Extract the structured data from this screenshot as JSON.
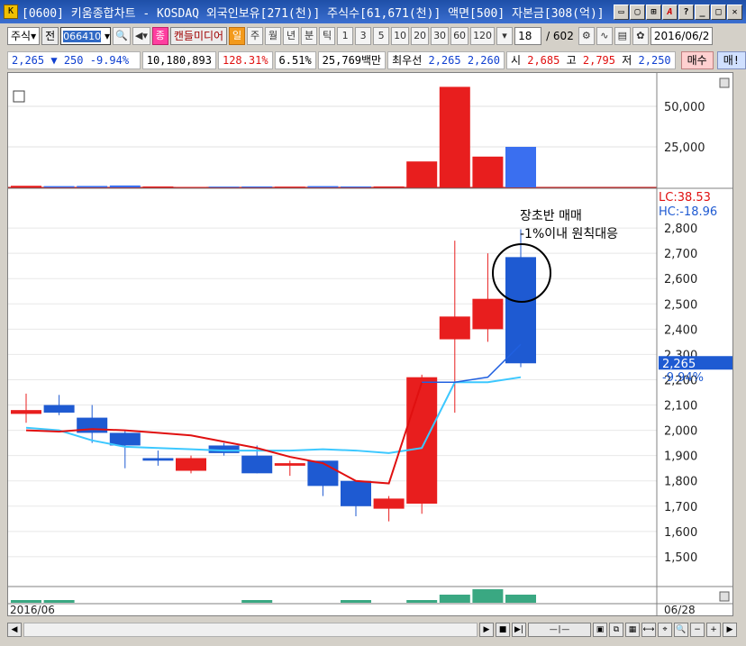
{
  "window": {
    "title": "[0600] 키움종합차트 - KOSDAQ 외국인보유[271(천)] 주식수[61,671(천)] 액면[500] 자본금[308(억)]",
    "icons": [
      "minimize-window-icon",
      "restore-window-icon",
      "pin-icon",
      "font-icon",
      "help-icon",
      "minimize-icon",
      "maximize-icon",
      "close-icon"
    ]
  },
  "toolbar": {
    "type_select": "주식",
    "all_label": "전",
    "code": "066410",
    "theme_btn": "종",
    "candle_btn": "캔들미디어",
    "period_daily": "일",
    "period_weekly": "주",
    "period_monthly": "월",
    "period_yearly": "년",
    "period_minute": "분",
    "period_tick": "틱",
    "minute_options": [
      "1",
      "3",
      "5",
      "10",
      "20",
      "30",
      "60",
      "120"
    ],
    "count_value": "18",
    "total_count": "/ 602",
    "date": "2016/06/2"
  },
  "quote": {
    "price": "2,265",
    "change": "250",
    "change_pct": "-9.94%",
    "volume": "10,180,893",
    "vol_ratio": "128.31%",
    "turnover": "6.51%",
    "amount": "25,769백만",
    "best_label": "최우선",
    "ask": "2,265",
    "bid": "2,260",
    "open_label": "시",
    "open": "2,685",
    "high_label": "고",
    "high": "2,795",
    "low_label": "저",
    "low": "2,250",
    "buy_button": "매수",
    "sell_button": "매!"
  },
  "chart_labels": {
    "lc": "LC:38.53",
    "hc": "HC:-18.96",
    "current_price": "2,265",
    "current_pct": "-9.94%",
    "annotation_line1": "장초반 매매",
    "annotation_line2": "-1%이내 원칙대응",
    "date_start": "2016/06",
    "date_end": "06/28"
  },
  "chart_data": [
    {
      "type": "bar",
      "title": "",
      "yticks": [
        "25,000",
        "50,000"
      ],
      "ylim": [
        0,
        65000
      ],
      "values": [
        1000,
        800,
        900,
        1200,
        600,
        300,
        500,
        600,
        500,
        800,
        600,
        600,
        16000,
        62000,
        19000,
        25000
      ],
      "colors": [
        "red",
        "blue",
        "blue",
        "blue",
        "red",
        "red",
        "blue",
        "blue",
        "red",
        "blue",
        "blue",
        "red",
        "red",
        "red",
        "red",
        "blue"
      ]
    },
    {
      "type": "candlestick",
      "title": "",
      "yticks": [
        "1,500",
        "1,600",
        "1,700",
        "1,800",
        "1,900",
        "2,000",
        "2,100",
        "2,200",
        "2,300",
        "2,400",
        "2,500",
        "2,600",
        "2,700",
        "2,800"
      ],
      "ylim": [
        1400,
        2950
      ],
      "candles": [
        {
          "o": 2065,
          "h": 2145,
          "l": 2030,
          "c": 2080
        },
        {
          "o": 2100,
          "h": 2140,
          "l": 2060,
          "c": 2070
        },
        {
          "o": 2050,
          "h": 2100,
          "l": 1950,
          "c": 1990
        },
        {
          "o": 1990,
          "h": 2000,
          "l": 1850,
          "c": 1940
        },
        {
          "o": 1890,
          "h": 1920,
          "l": 1860,
          "c": 1880
        },
        {
          "o": 1840,
          "h": 1900,
          "l": 1830,
          "c": 1890
        },
        {
          "o": 1940,
          "h": 1950,
          "l": 1900,
          "c": 1910
        },
        {
          "o": 1900,
          "h": 1940,
          "l": 1830,
          "c": 1830
        },
        {
          "o": 1860,
          "h": 1880,
          "l": 1820,
          "c": 1870
        },
        {
          "o": 1880,
          "h": 1880,
          "l": 1740,
          "c": 1780
        },
        {
          "o": 1800,
          "h": 1800,
          "l": 1660,
          "c": 1700
        },
        {
          "o": 1690,
          "h": 1740,
          "l": 1640,
          "c": 1730
        },
        {
          "o": 1710,
          "h": 2220,
          "l": 1670,
          "c": 2210
        },
        {
          "o": 2360,
          "h": 2750,
          "l": 2070,
          "c": 2450
        },
        {
          "o": 2400,
          "h": 2700,
          "l": 2350,
          "c": 2520
        },
        {
          "o": 2685,
          "h": 2795,
          "l": 2250,
          "c": 2265
        }
      ],
      "ma_short": [
        2000,
        1995,
        2005,
        2000,
        1990,
        1980,
        1955,
        1930,
        1895,
        1870,
        1800,
        1790,
        2190,
        2190,
        2210,
        2340
      ],
      "ma_long": [
        2010,
        2000,
        1960,
        1935,
        1930,
        1925,
        1920,
        1920,
        1920,
        1925,
        1920,
        1910,
        1930,
        2190,
        2190,
        2210
      ]
    },
    {
      "type": "bar",
      "title": "",
      "values": [
        1,
        1,
        0,
        0,
        0,
        0,
        0,
        1,
        0,
        0,
        1,
        0,
        1,
        3,
        5,
        3
      ]
    }
  ]
}
